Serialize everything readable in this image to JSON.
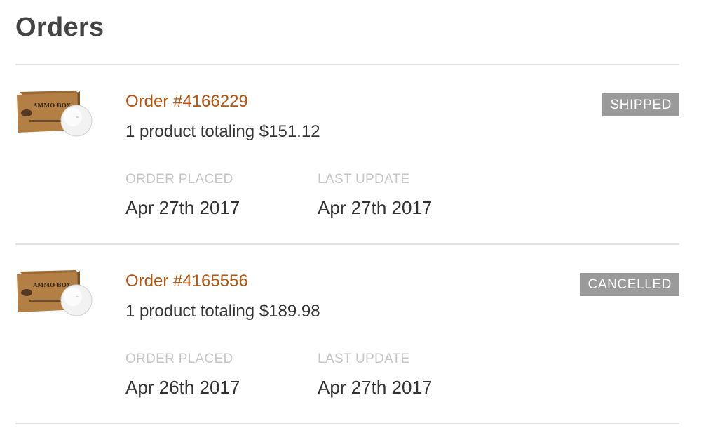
{
  "page": {
    "title": "Orders"
  },
  "orders": [
    {
      "order_label": "Order #4166229",
      "summary": "1 product totaling $151.12",
      "status": "SHIPPED",
      "placed_label": "ORDER PLACED",
      "placed_date": "Apr 27th 2017",
      "updated_label": "LAST UPDATE",
      "updated_date": "Apr 27th 2017",
      "box_text": "AMMO BOX"
    },
    {
      "order_label": "Order #4165556",
      "summary": "1 product totaling $189.98",
      "status": "CANCELLED",
      "placed_label": "ORDER PLACED",
      "placed_date": "Apr 26th 2017",
      "updated_label": "LAST UPDATE",
      "updated_date": "Apr 27th 2017",
      "box_text": "AMMO BOX"
    }
  ],
  "colors": {
    "link": "#b5540f",
    "badge_bg": "#9a9a9a",
    "divider": "#e2e2e2",
    "muted_label": "#c6c6c6"
  },
  "icons": {
    "product_thumbnail": "ammo-box-golf-ball-thumbnail"
  }
}
